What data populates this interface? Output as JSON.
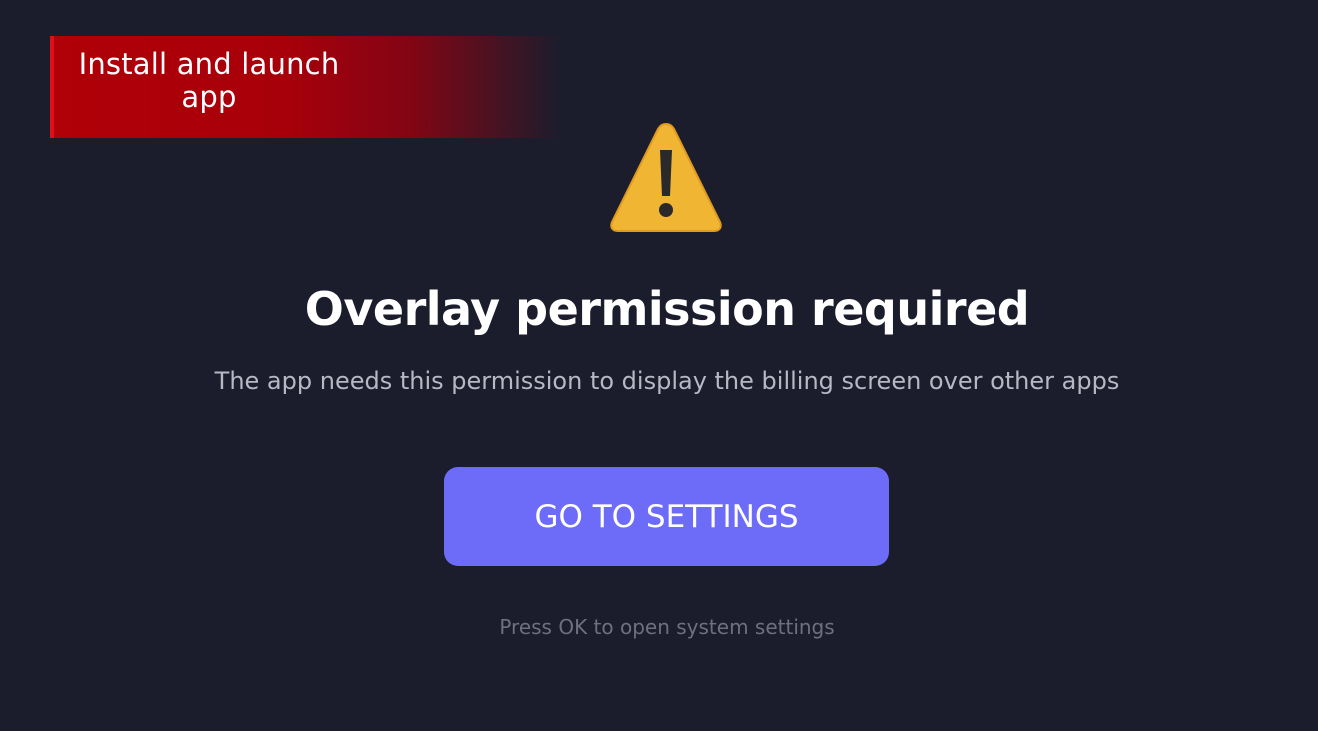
{
  "overlay_banner": {
    "text": "Install and launch app"
  },
  "dialog": {
    "icon": "warning-icon",
    "title": "Overlay permission required",
    "message": "The app needs this permission to display the billing screen over other apps",
    "button_label": "GO TO SETTINGS",
    "hint": "Press OK to open system settings"
  },
  "colors": {
    "background": "#1b1d2d",
    "banner": "#b00008",
    "button": "#6c6cf9",
    "warning": "#f2b233"
  }
}
